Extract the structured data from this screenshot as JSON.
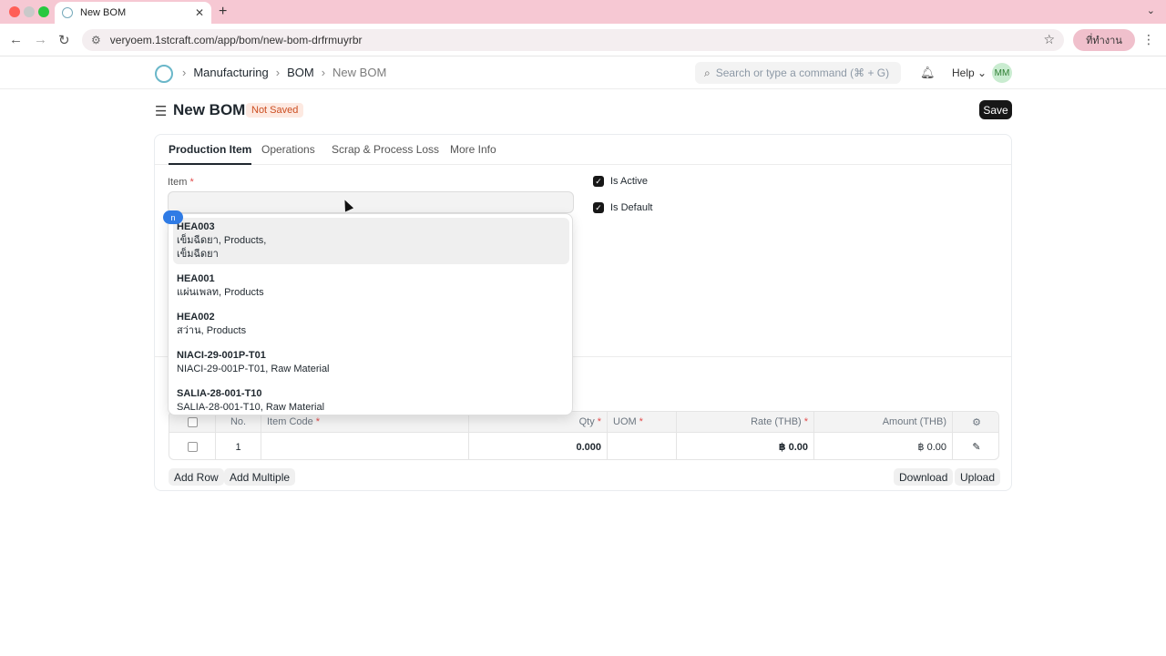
{
  "browser": {
    "tab_title": "New BOM",
    "url": "veryoem.1stcraft.com/app/bom/new-bom-drfrmuyrbr",
    "profile_label": "ที่ทำงาน",
    "colors": {
      "tabbar": "#f6c8d3",
      "close": "#ff5f57",
      "minimize": "#febc2e",
      "maximize": "#28c840"
    }
  },
  "navbar": {
    "breadcrumb": [
      "Manufacturing",
      "BOM",
      "New BOM"
    ],
    "search_placeholder": "Search or type a command (⌘ + G)",
    "help_label": "Help",
    "avatar_initials": "MM"
  },
  "page": {
    "title": "New BOM",
    "status_badge": "Not Saved",
    "save_label": "Save"
  },
  "form_tabs": [
    "Production Item",
    "Operations",
    "Scrap & Process Loss",
    "More Info"
  ],
  "form": {
    "item_label": "Item",
    "item_value": "",
    "is_active_label": "Is Active",
    "is_active": true,
    "is_default_label": "Is Default",
    "is_default": true
  },
  "dropdown": {
    "badge": "n",
    "items": [
      {
        "code": "HEA003",
        "line2": "เข็มฉีดยา, Products,",
        "line3": "เข็มฉีดยา",
        "highlighted": true
      },
      {
        "code": "HEA001",
        "line2": "แผ่นเพลท, Products"
      },
      {
        "code": "HEA002",
        "line2": "สว่าน, Products"
      },
      {
        "code": "NIACI-29-001P-T01",
        "line2": "NIACI-29-001P-T01, Raw Material"
      },
      {
        "code": "SALIA-28-001-T10",
        "line2": "SALIA-28-001-T10, Raw Material"
      }
    ]
  },
  "table": {
    "headers": {
      "no": "No.",
      "item_code": "Item Code",
      "qty": "Qty",
      "uom": "UOM",
      "rate": "Rate (THB)",
      "amount": "Amount (THB)"
    },
    "rows": [
      {
        "no": "1",
        "item_code": "",
        "qty": "0.000",
        "uom": "",
        "rate": "฿ 0.00",
        "amount": "฿ 0.00"
      }
    ]
  },
  "table_buttons": {
    "add_row": "Add Row",
    "add_multiple": "Add Multiple",
    "download": "Download",
    "upload": "Upload"
  },
  "required_mark": "*"
}
